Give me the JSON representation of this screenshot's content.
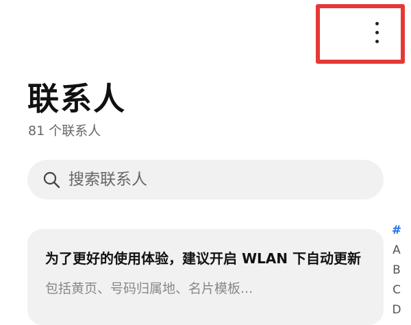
{
  "header": {
    "title": "联系人",
    "subtitle": "81 个联系人",
    "more_icon": "more-vertical-icon"
  },
  "search": {
    "placeholder": "搜索联系人",
    "icon": "search-icon"
  },
  "wlan_prompt": {
    "title": "为了更好的使用体验，建议开启 WLAN 下自动更新",
    "description": "包括黄页、号码归属地、名片模板..."
  },
  "alphabet_index": [
    "#",
    "A",
    "B",
    "C",
    "D"
  ],
  "colors": {
    "highlight": "#e53935",
    "accent": "#1a73e8",
    "surface": "#f1f1f1"
  }
}
